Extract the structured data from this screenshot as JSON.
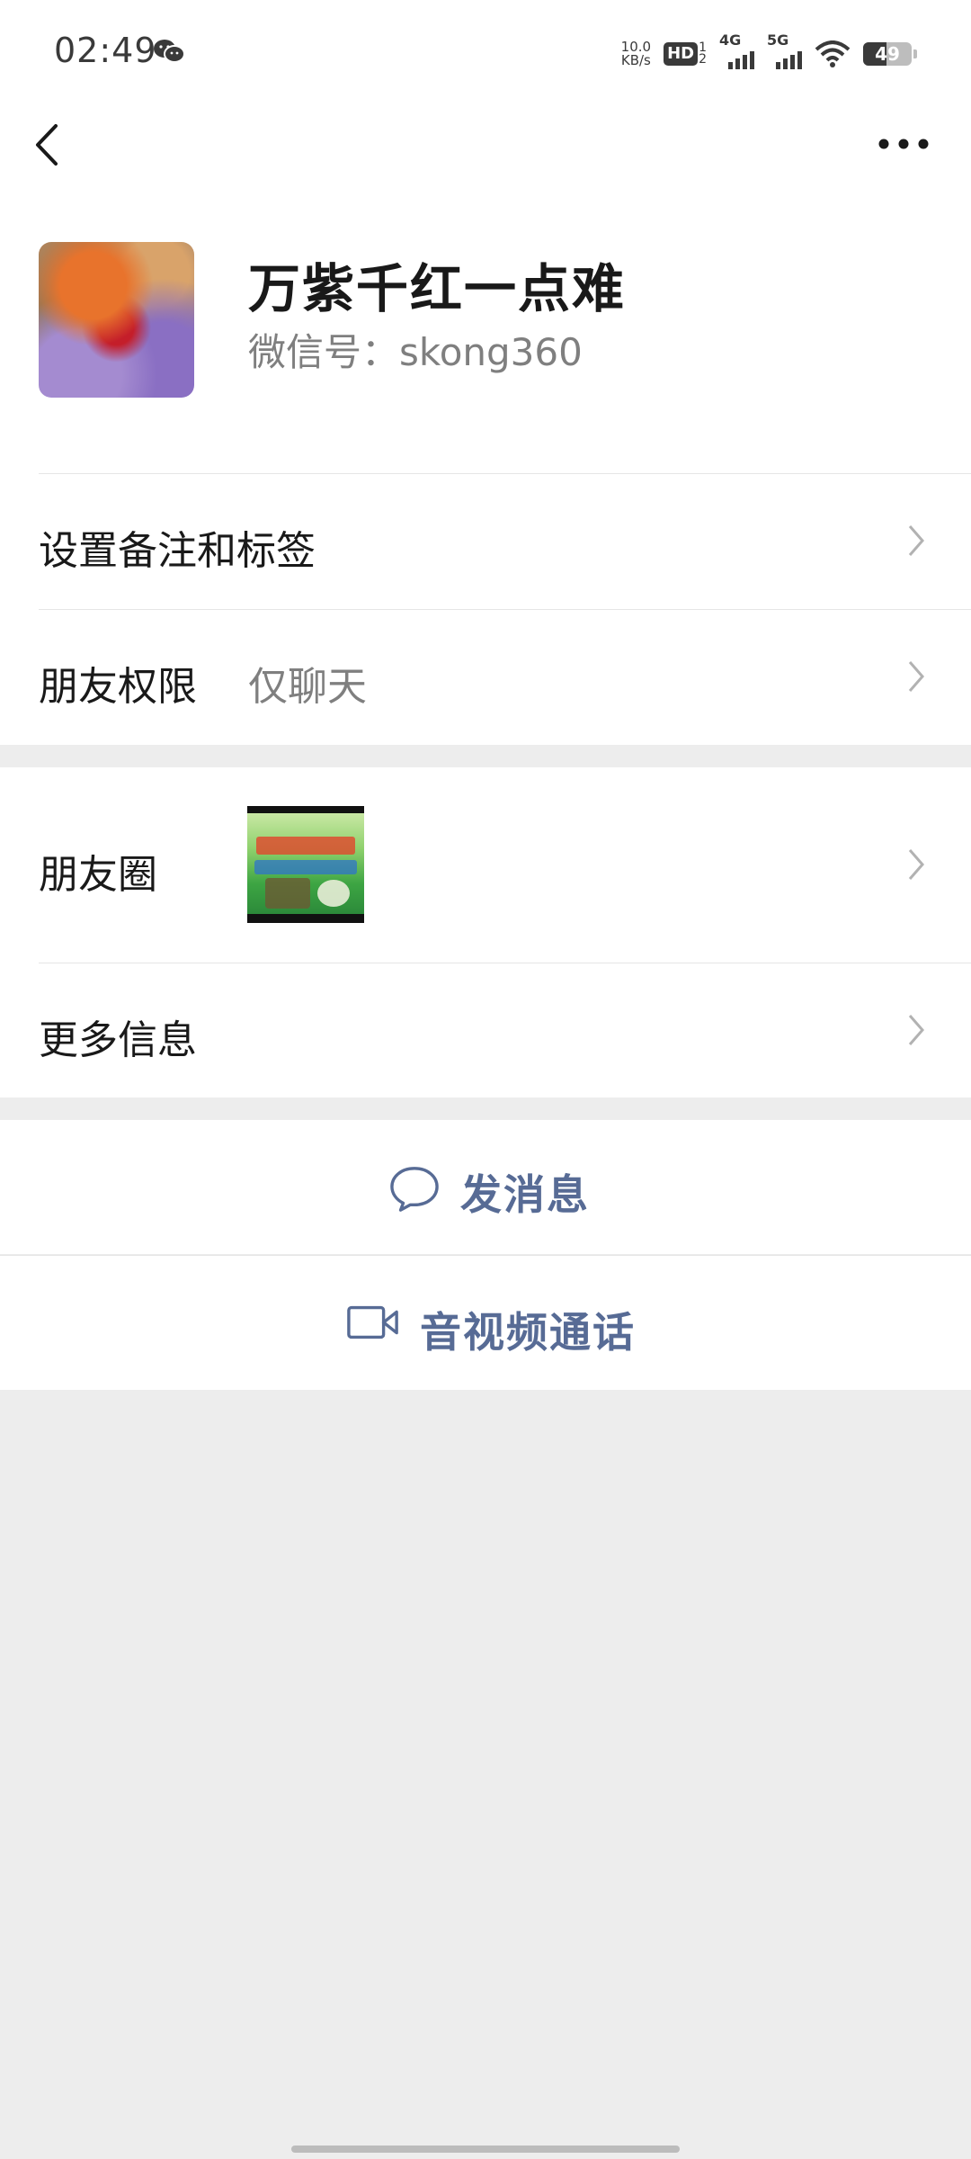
{
  "status_bar": {
    "time": "02:49",
    "net_speed_value": "10.0",
    "net_speed_unit": "KB/s",
    "hd_label": "HD",
    "hd_sub": "1\n2",
    "signal1_label": "4G",
    "signal2_label": "5G",
    "battery": "49",
    "battery_level": 0.49
  },
  "profile": {
    "name": "万紫千红一点难",
    "wechat_id": "微信号：skong360"
  },
  "rows": {
    "remark": {
      "label": "设置备注和标签"
    },
    "permission": {
      "label": "朋友权限",
      "value": "仅聊天"
    },
    "moments": {
      "label": "朋友圈"
    },
    "more_info": {
      "label": "更多信息"
    }
  },
  "actions": {
    "send_message": "发消息",
    "video_call": "音视频通话"
  },
  "colors": {
    "accent_link": "#576b95",
    "page_bg": "#ededed",
    "card_bg": "#ffffff"
  },
  "icons": {
    "back": "chevron-left-icon",
    "more": "more-dots-icon",
    "message": "chat-bubble-icon",
    "video": "video-camera-icon"
  }
}
